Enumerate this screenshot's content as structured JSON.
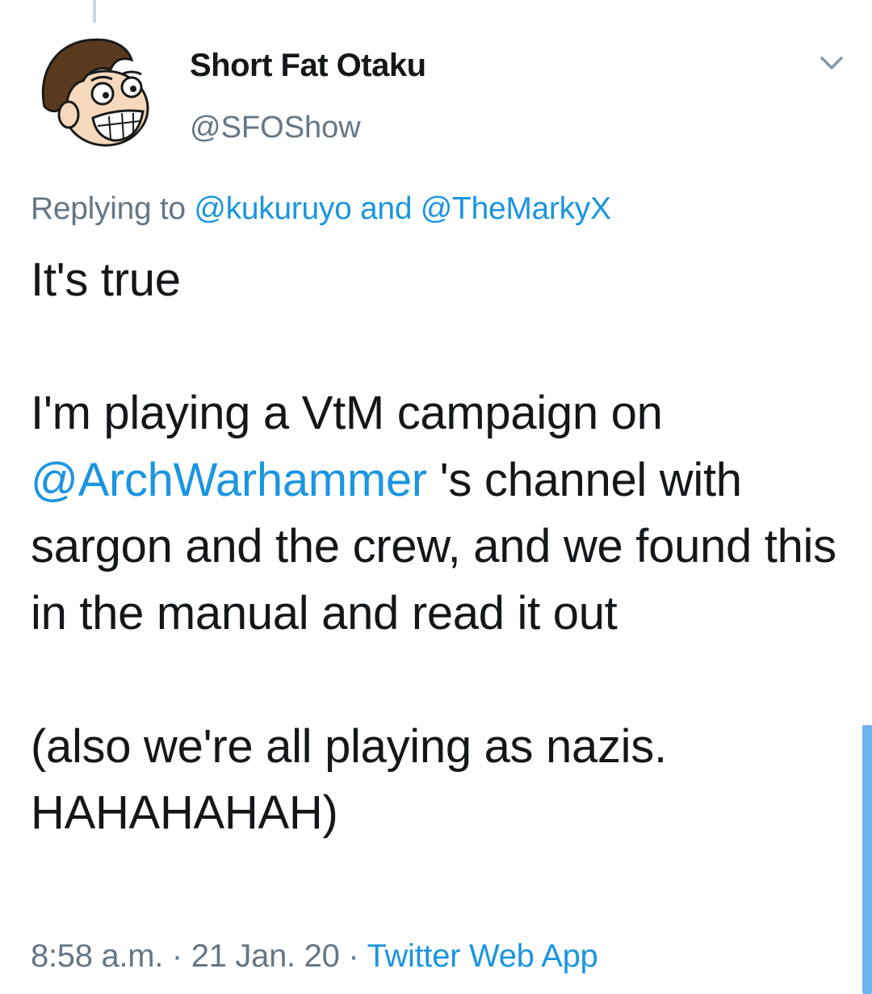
{
  "tweet": {
    "author": {
      "display_name": "Short Fat Otaku",
      "handle": "@SFOShow"
    },
    "reply_context": {
      "prefix": "Replying to ",
      "mention_1": "@kukuruyo",
      "conjunction": " and ",
      "mention_2": "@TheMarkyX"
    },
    "body": {
      "line_1": "It's true",
      "para_2_before": "I'm playing a VtM campaign on ",
      "para_2_mention": "@ArchWarhammer",
      "para_2_after": " 's channel with sargon and the crew, and we found this in the manual and read it out",
      "para_3": "(also we're all playing as nazis. HAHAHAHAH)"
    },
    "meta": {
      "time": "8:58 a.m.",
      "separator_1": " · ",
      "date": "21 Jan. 20",
      "separator_2": " · ",
      "source": "Twitter Web App"
    }
  },
  "icons": {
    "more_menu": "chevron-down-icon",
    "avatar": "cartoon-avatar"
  },
  "colors": {
    "link": "#1b95e0",
    "secondary_text": "#657786",
    "primary_text": "#14171a",
    "thread_line": "#ccd6dd",
    "scrollbar": "#6cb4ee"
  }
}
